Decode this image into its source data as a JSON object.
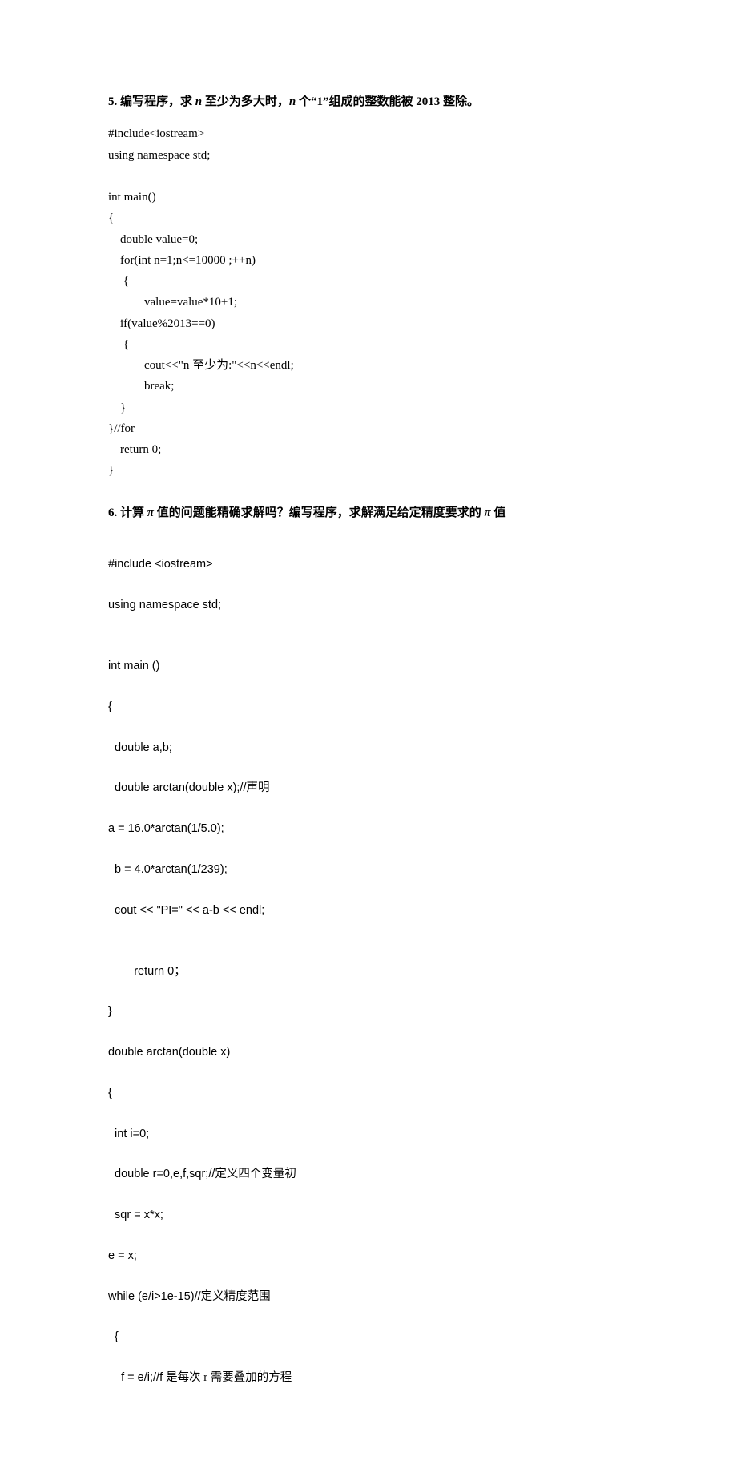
{
  "q5": {
    "heading_pre": "5.  编写程序，求 ",
    "var": "n",
    "heading_mid": " 至少为多大时，",
    "heading_mid2": " 个“1”组成的整数能被 2013 整除。",
    "code": "#include<iostream>\nusing namespace std;\n\nint main()\n{\n    double value=0;\n    for(int n=1;n<=10000 ;++n)\n     {\n            value=value*10+1;\n    if(value%2013==0)\n     {\n            cout<<\"n 至少为:\"<<n<<endl;\n            break;\n    }\n}//for\n    return 0;\n}"
  },
  "q6": {
    "heading_pre": "6.  计算 ",
    "pi": "π",
    "heading_mid": " 值的问题能精确求解吗？编写程序，求解满足给定精度要求的 ",
    "heading_end": " 值",
    "code_l1": "#include <iostream>",
    "code_l2": "using namespace std;",
    "code_l3": "",
    "code_l4": "int main ()",
    "code_l5": "{",
    "code_l6": "  double a,b;",
    "code_l7a": "  double arctan(double x);//",
    "code_l7b": "声明",
    "code_l8": "a = 16.0*arctan(1/5.0);",
    "code_l9": "  b = 4.0*arctan(1/239);",
    "code_l10": "  cout << \"PI=\" << a-b << endl;",
    "code_l11": "",
    "code_l12": "        return 0；",
    "code_l13": "}",
    "code_l14": "double arctan(double x)",
    "code_l15": "{",
    "code_l16": "  int i=0;",
    "code_l17a": "  double r=0,e,f,sqr;//",
    "code_l17b": "定义四个变量初",
    "code_l18": "  sqr = x*x;",
    "code_l19": "e = x;",
    "code_l20a": "while (e/i>1e-15)//",
    "code_l20b": "定义精度范围",
    "code_l21": "  {",
    "code_l22a": "    f = e/i;//f ",
    "code_l22b": "是每次 r 需要叠加的方程"
  }
}
